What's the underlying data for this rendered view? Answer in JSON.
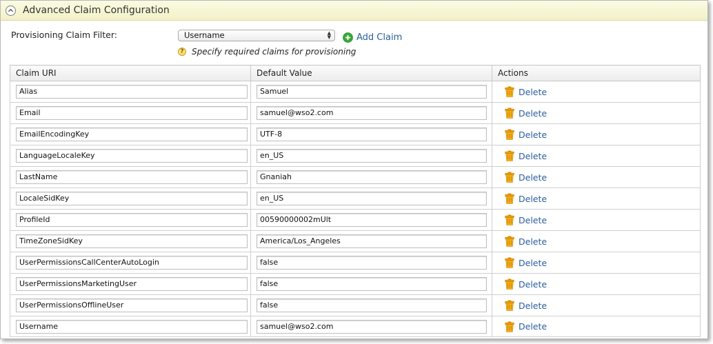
{
  "section": {
    "title": "Advanced Claim Configuration"
  },
  "filter": {
    "label": "Provisioning Claim Filter:",
    "selected": "Username",
    "add_claim_label": "Add Claim",
    "hint": "Specify required claims for provisioning"
  },
  "table": {
    "headers": [
      "Claim URI",
      "Default Value",
      "Actions"
    ],
    "rows": [
      {
        "uri": "Alias",
        "value": "Samuel",
        "action": "Delete"
      },
      {
        "uri": "Email",
        "value": "samuel@wso2.com",
        "action": "Delete"
      },
      {
        "uri": "EmailEncodingKey",
        "value": "UTF-8",
        "action": "Delete"
      },
      {
        "uri": "LanguageLocaleKey",
        "value": "en_US",
        "action": "Delete"
      },
      {
        "uri": "LastName",
        "value": "Gnaniah",
        "action": "Delete"
      },
      {
        "uri": "LocaleSidKey",
        "value": "en_US",
        "action": "Delete"
      },
      {
        "uri": "ProfileId",
        "value": "00590000002mUlt",
        "action": "Delete"
      },
      {
        "uri": "TimeZoneSidKey",
        "value": "America/Los_Angeles",
        "action": "Delete"
      },
      {
        "uri": "UserPermissionsCallCenterAutoLogin",
        "value": "false",
        "action": "Delete"
      },
      {
        "uri": "UserPermissionsMarketingUser",
        "value": "false",
        "action": "Delete"
      },
      {
        "uri": "UserPermissionsOfflineUser",
        "value": "false",
        "action": "Delete"
      },
      {
        "uri": "Username",
        "value": "samuel@wso2.com",
        "action": "Delete"
      }
    ]
  },
  "icons": {
    "collapse": "chevron-up-icon",
    "add": "plus-circle-icon",
    "hint": "question-icon",
    "delete": "trash-icon"
  },
  "colors": {
    "header_bg": "#f4f4d0",
    "link": "#2a5d9f",
    "add_icon": "#3aa53a",
    "trash": "#f0a000"
  }
}
